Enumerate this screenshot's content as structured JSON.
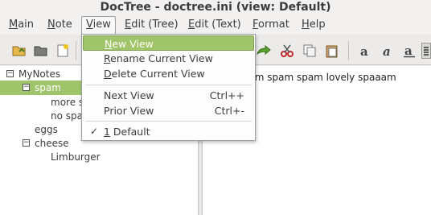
{
  "window": {
    "title": "DocTree - doctree.ini (view: Default)"
  },
  "menubar": {
    "items": [
      {
        "label": "Main",
        "mnemonic": "M",
        "rest": "ain"
      },
      {
        "label": "Note",
        "mnemonic": "N",
        "rest": "ote"
      },
      {
        "label": "View",
        "mnemonic": "V",
        "rest": "iew"
      },
      {
        "label": "Edit (Tree)",
        "mnemonic": "E",
        "rest": "dit (Tree)"
      },
      {
        "label": "Edit (Text)",
        "mnemonic": "E",
        "rest": "dit (Text)"
      },
      {
        "label": "Format",
        "mnemonic": "F",
        "rest": "ormat"
      },
      {
        "label": "Help",
        "mnemonic": "H",
        "rest": "elp"
      }
    ]
  },
  "toolbar": {
    "icons": [
      "open-folder-icon",
      "folder-icon",
      "new-note-icon",
      "redo-arrow-icon",
      "cut-scissors-icon",
      "copy-icon",
      "paste-icon",
      "bold-a-icon",
      "italic-a-icon",
      "underline-a-icon",
      "align-icon"
    ]
  },
  "tree": {
    "root": "MyNotes",
    "nodes": [
      {
        "label": "spam",
        "level": 1,
        "expanded": true,
        "selected": true
      },
      {
        "label": "more s",
        "level": 2
      },
      {
        "label": "no spa",
        "level": 2
      },
      {
        "label": "eggs",
        "level": 1
      },
      {
        "label": "cheese",
        "level": 1,
        "expanded": true
      },
      {
        "label": "Limburger",
        "level": 2
      }
    ]
  },
  "editor": {
    "text": "m spam spam spam lovely spaaam"
  },
  "view_menu": {
    "items": [
      {
        "label": "New View",
        "mnemonic": "N",
        "rest": "ew View",
        "accel": "",
        "highlighted": true
      },
      {
        "label": "Rename Current View",
        "mnemonic": "R",
        "rest": "ename Current View",
        "accel": ""
      },
      {
        "label": "Delete Current View",
        "mnemonic": "D",
        "rest": "elete Current View",
        "accel": ""
      },
      {
        "label": "Next View",
        "mnemonic": "",
        "rest": "Next View",
        "accel": "Ctrl++"
      },
      {
        "label": "Prior View",
        "mnemonic": "",
        "rest": "Prior View",
        "accel": "Ctrl+-"
      },
      {
        "label": "1 Default",
        "mnemonic": "1",
        "rest": " Default",
        "accel": "",
        "checked": true
      }
    ]
  },
  "colors": {
    "accent": "#9fc46a",
    "menu_bg": "#fdfdfd",
    "window_bg": "#f2f1f0"
  }
}
